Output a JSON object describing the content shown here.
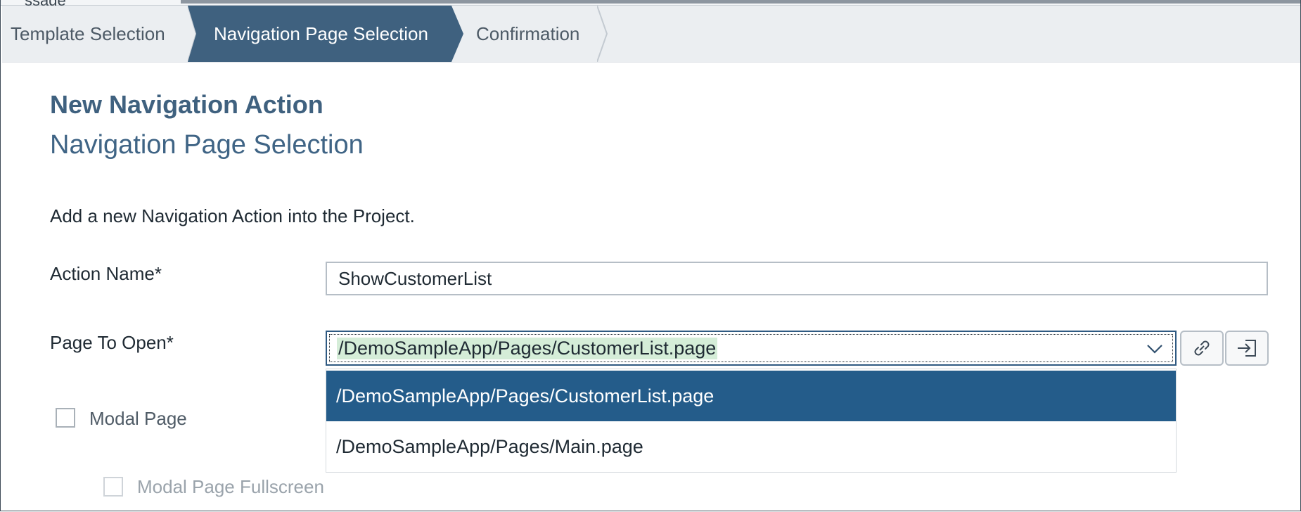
{
  "top_strip": {
    "text": "ssage"
  },
  "wizard": {
    "steps": [
      {
        "label": "Template Selection",
        "state": "completed"
      },
      {
        "label": "Navigation Page Selection",
        "state": "active"
      },
      {
        "label": "Confirmation",
        "state": "pending"
      }
    ]
  },
  "header": {
    "title": "New Navigation Action",
    "subtitle": "Navigation Page Selection"
  },
  "description": "Add a new Navigation Action into the Project.",
  "form": {
    "action_name": {
      "label": "Action Name*",
      "value": "ShowCustomerList"
    },
    "page_to_open": {
      "label": "Page To Open*",
      "value": "/DemoSampleApp/Pages/CustomerList.page",
      "options": [
        "/DemoSampleApp/Pages/CustomerList.page",
        "/DemoSampleApp/Pages/Main.page"
      ],
      "selected_index": 0
    },
    "modal_page": {
      "label": "Modal Page",
      "checked": false
    },
    "modal_page_fullscreen": {
      "label": "Modal Page Fullscreen",
      "checked": false,
      "disabled": true
    }
  },
  "icons": {
    "combo_arrow": "chevron-down-icon",
    "link_button": "link-icon",
    "open_button": "open-page-icon"
  },
  "colors": {
    "active_step": "#3f617f",
    "selected_option": "#245c8a",
    "title": "#3f617f",
    "highlight": "#d5edd8"
  }
}
